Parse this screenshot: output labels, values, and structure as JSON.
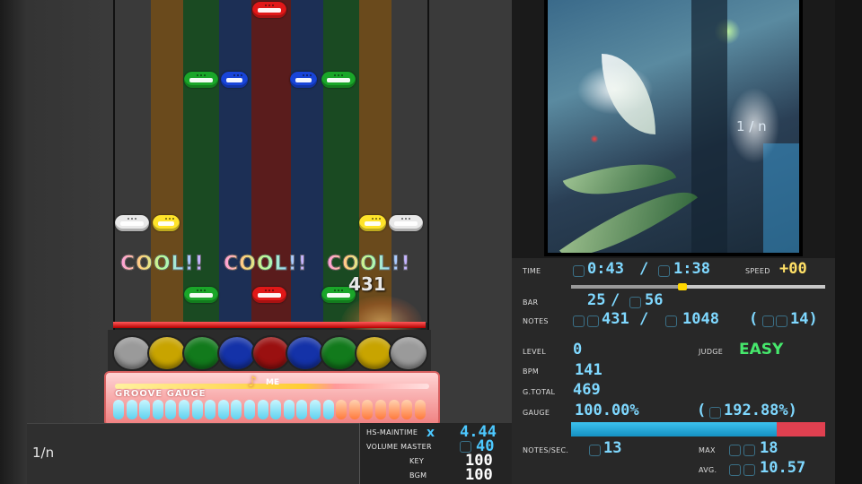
{
  "playfield": {
    "lane_colors": [
      "#3a3a3a",
      "#6a4a1c",
      "#1a4a22",
      "#1c2f55",
      "#5a1c1c",
      "#1c2f55",
      "#1a4a22",
      "#6a4a1c",
      "#3a3a3a"
    ],
    "judgements": [
      "COOL!!",
      "COOL!!",
      "COOL!!"
    ],
    "combo": "431"
  },
  "groove_gauge": {
    "label": "GROOVE GAUGE",
    "badge_text": "ME",
    "segments_total": 24,
    "segments_filled": 17
  },
  "song": {
    "title": "1/n"
  },
  "hs_panel": {
    "hs_label": "HS-MAINTIME",
    "multiplier_symbol": "x",
    "hs_value": "4.44",
    "volume_master_label": "VOLUME  MASTER",
    "master_value": "40",
    "key_label": "KEY",
    "key_value": "100",
    "bgm_label": "BGM",
    "bgm_value": "100"
  },
  "bga": {
    "overlay_text": "1 / n"
  },
  "stats": {
    "time_label": "TIME",
    "time_current": "0:43",
    "time_sep": "/",
    "time_total": "1:38",
    "time_progress": 0.439,
    "speed_label": "SPEED",
    "speed_value": "+00",
    "bar_label": "BAR",
    "bar_current": "25",
    "bar_sep": "/",
    "bar_total": "56",
    "notes_label": "NOTES",
    "notes_current": "431",
    "notes_sep": "/",
    "notes_total": "1048",
    "notes_paren": "(",
    "notes_extra": "14)",
    "level_label": "LEVEL",
    "level_value": "0",
    "judge_label": "JUDGE",
    "judge_value": "EASY",
    "bpm_label": "BPM",
    "bpm_value": "141",
    "gtotal_label": "G.TOTAL",
    "gtotal_value": "469",
    "gauge_label": "GAUGE",
    "gauge_value": "100.00%",
    "gauge_paren": "(",
    "gauge_extra": "192.88%)",
    "gauge_fill": 0.81,
    "nps_label": "NOTES/SEC.",
    "nps_value": "13",
    "max_label": "MAX",
    "max_value": "18",
    "avg_label": "AVG.",
    "avg_value": "10.57"
  },
  "colors": {
    "stat_value": "#7fd8ff",
    "speed": "#ffe066",
    "judge_easy": "#46e86c",
    "gauge_blue": "#1590c2",
    "gauge_red": "#e04050"
  }
}
